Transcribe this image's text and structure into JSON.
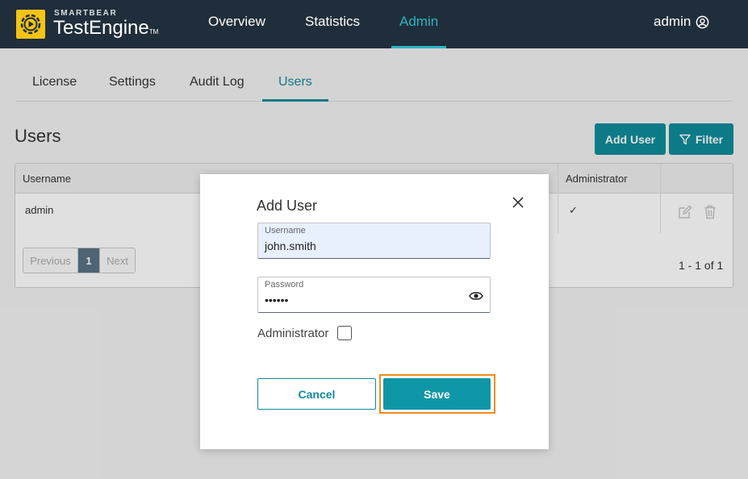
{
  "brand": {
    "company": "SMARTBEAR",
    "product": "TestEngine",
    "tm": "TM",
    "logo_color": "#f3c316"
  },
  "nav": {
    "items": [
      "Overview",
      "Statistics",
      "Admin"
    ],
    "active": "Admin",
    "user": "admin"
  },
  "subtabs": {
    "items": [
      "License",
      "Settings",
      "Audit Log",
      "Users"
    ],
    "active": "Users"
  },
  "page": {
    "title": "Users",
    "add_user_label": "Add User",
    "filter_label": "Filter"
  },
  "table": {
    "headers": {
      "username": "Username",
      "administrator": "Administrator"
    },
    "rows": [
      {
        "username": "admin",
        "administrator": "✓"
      }
    ],
    "pager": {
      "previous": "Previous",
      "current": "1",
      "next": "Next"
    },
    "count": "1 - 1 of 1"
  },
  "modal": {
    "title": "Add User",
    "username": {
      "label": "Username",
      "value": "john.smith"
    },
    "password": {
      "label": "Password",
      "value": "••••••"
    },
    "administrator_label": "Administrator",
    "administrator_checked": false,
    "cancel_label": "Cancel",
    "save_label": "Save",
    "highlight_color": "#f08c1a"
  },
  "colors": {
    "topbar": "#1f2e3a",
    "accent": "#2bb5c4",
    "primary": "#0f8c9a"
  }
}
